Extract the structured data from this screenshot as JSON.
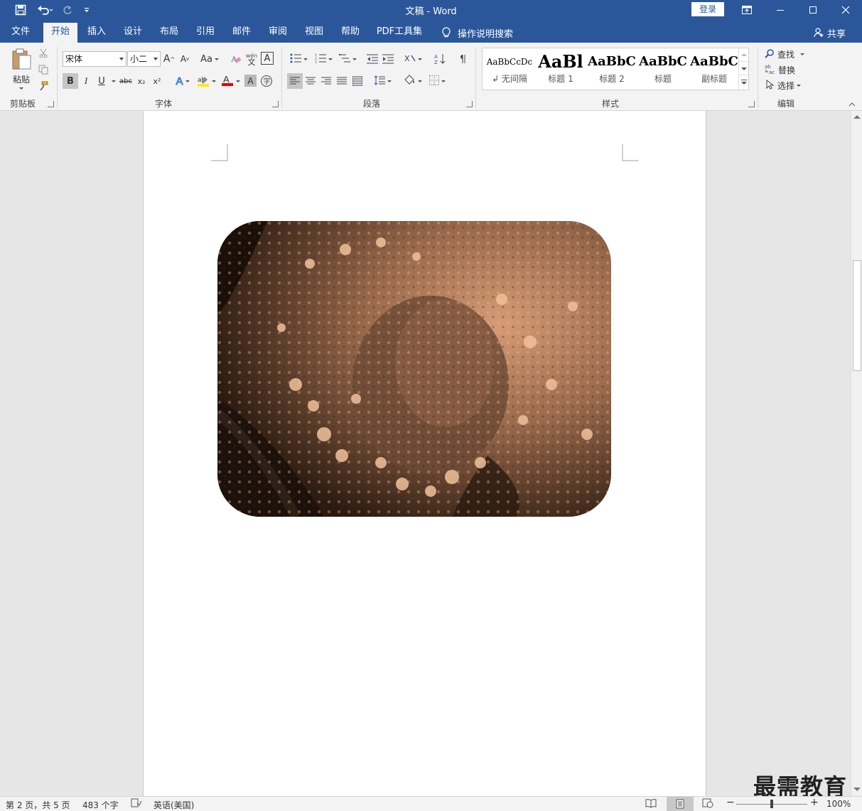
{
  "titlebar": {
    "title": "文稿  -  Word",
    "login_label": "登录",
    "quick_access": [
      "save-icon",
      "undo-icon",
      "redo-icon",
      "customize-icon"
    ]
  },
  "tabs": {
    "file": "文件",
    "home": "开始",
    "insert": "插入",
    "design": "设计",
    "layout": "布局",
    "references": "引用",
    "mailings": "邮件",
    "review": "审阅",
    "view": "视图",
    "help": "帮助",
    "pdf": "PDF工具集",
    "tell_me": "操作说明搜索",
    "share": "共享"
  },
  "ribbon": {
    "clipboard": {
      "paste_label": "粘贴",
      "group_label": "剪贴板"
    },
    "font": {
      "font_name": "宋体",
      "font_size": "小二",
      "group_label": "字体",
      "case_label": "Aa",
      "bold": "B",
      "italic": "I",
      "underline": "U",
      "strike": "abc",
      "subscript": "x₂",
      "superscript": "x²"
    },
    "paragraph": {
      "group_label": "段落"
    },
    "styles": {
      "group_label": "样式",
      "items": [
        {
          "preview": "AaBbCcDc",
          "name": "↲ 无间隔"
        },
        {
          "preview": "AaBl",
          "name": "标题 1"
        },
        {
          "preview": "AaBbC",
          "name": "标题 2"
        },
        {
          "preview": "AaBbC",
          "name": "标题"
        },
        {
          "preview": "AaBbC",
          "name": "副标题"
        }
      ]
    },
    "editing": {
      "group_label": "编辑",
      "find": "查找",
      "replace": "替换",
      "select": "选择"
    }
  },
  "statusbar": {
    "page": "第 2 页，共 5 页",
    "words": "483 个字",
    "language": "英语(美国)",
    "zoom": "100%",
    "zoom_level": 0.5
  },
  "watermark": "最需教育",
  "colors": {
    "accent": "#2b579a",
    "ribbon": "#f3f3f3",
    "canvas": "#e6e6e6"
  }
}
